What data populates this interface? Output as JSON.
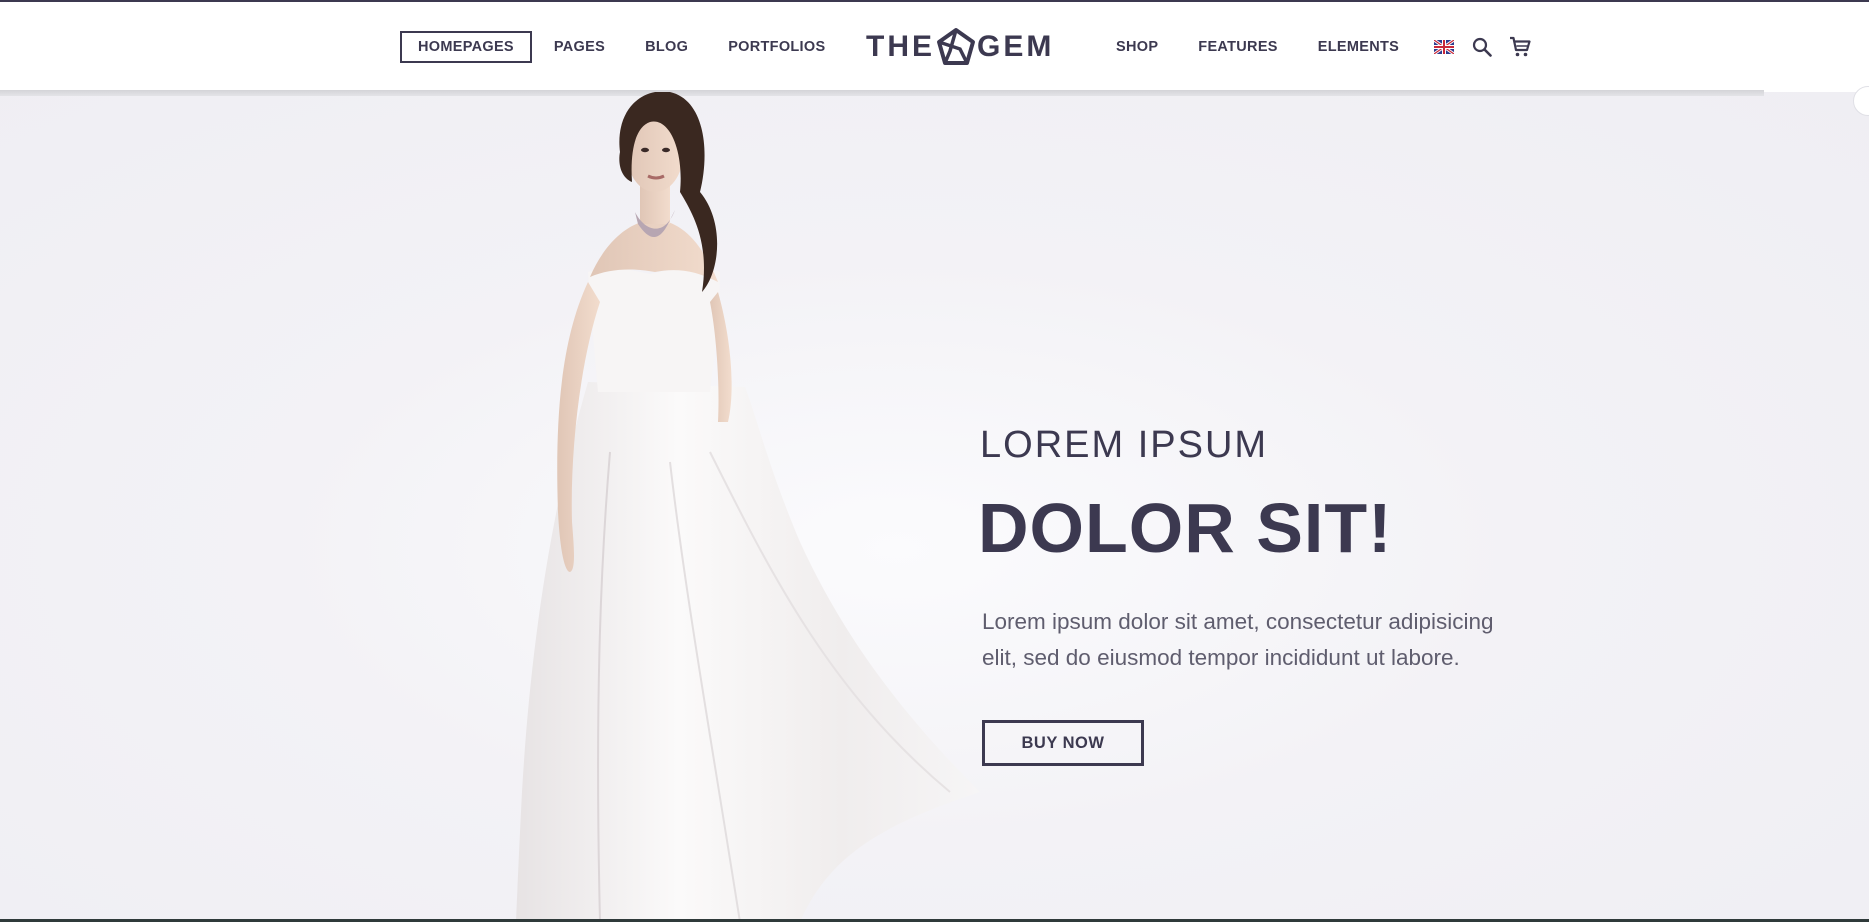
{
  "header": {
    "nav_left": [
      {
        "label": "HOMEPAGES",
        "active": true
      },
      {
        "label": "PAGES",
        "active": false
      },
      {
        "label": "BLOG",
        "active": false
      },
      {
        "label": "PORTFOLIOS",
        "active": false
      }
    ],
    "logo": {
      "left": "THE",
      "right": "GEM",
      "icon": "gem-pentagon-icon"
    },
    "nav_right": [
      {
        "label": "SHOP"
      },
      {
        "label": "FEATURES"
      },
      {
        "label": "ELEMENTS"
      }
    ],
    "icons": [
      "uk-flag-icon",
      "search-icon",
      "cart-icon"
    ]
  },
  "hero": {
    "subtitle": "LOREM IPSUM",
    "title": "DOLOR SIT!",
    "description": "Lorem ipsum dolor sit amet, consectetur adipisicing elit, sed do eiusmod tempor incididunt ut labore.",
    "button_label": "BUY NOW",
    "image": "woman-in-white-dress-photo"
  },
  "colors": {
    "text_dark": "#3c3950",
    "background": "#f1f0f4",
    "header_bg": "#ffffff"
  }
}
